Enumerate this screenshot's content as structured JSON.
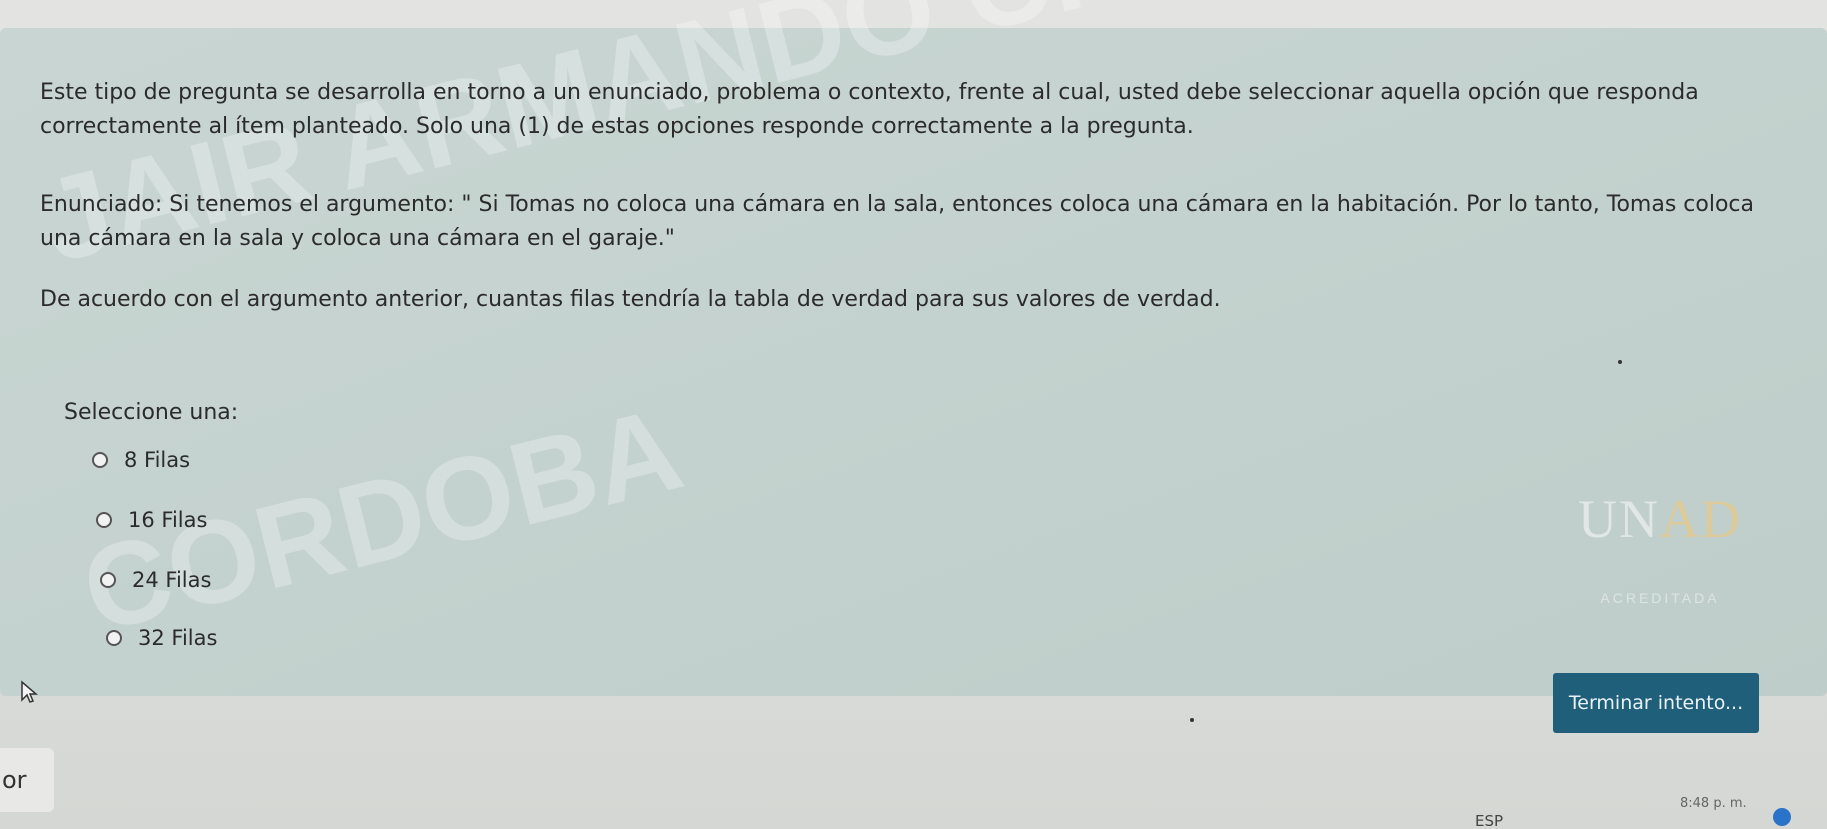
{
  "question": {
    "prompt": "Este tipo de pregunta se desarrolla en torno a un enunciado, problema o contexto, frente al cual, usted debe seleccionar aquella opción que responda correctamente al ítem planteado. Solo una (1) de estas opciones responde correctamente a la pregunta.",
    "statement": "Enunciado: Si tenemos el argumento: \" Si Tomas no coloca una cámara en la sala, entonces coloca una cámara en la habitación. Por lo tanto, Tomas coloca una cámara en la sala y coloca una cámara en el garaje.\"",
    "question_text": "De acuerdo con el argumento anterior, cuantas filas tendría la tabla de verdad para sus valores de verdad.",
    "select_label": "Seleccione una:",
    "options": [
      {
        "label": "8 Filas"
      },
      {
        "label": "16 Filas"
      },
      {
        "label": "24 Filas"
      },
      {
        "label": "32 Filas"
      }
    ]
  },
  "watermark": {
    "line1": "JAIR ARMANDO CHILITO",
    "line2": "CORDOBA"
  },
  "logo": {
    "text_main": "UN",
    "text_accent": "AD",
    "accreditation": "ACREDITADA"
  },
  "actions": {
    "finish_label": "Terminar intento..."
  },
  "sidebar": {
    "tab_text": "or"
  },
  "taskbar": {
    "language": "ESP",
    "time": "8:48 p. m."
  },
  "colors": {
    "card_background": "#c4d2cf",
    "finish_button": "#1f5f7a",
    "text": "#2b2b2b"
  }
}
